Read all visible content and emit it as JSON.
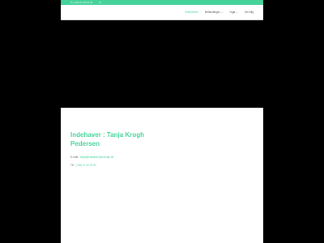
{
  "topbar": {
    "phone": "(+45) 21 43 43 00",
    "mail_icon": "envelope-icon",
    "phone_icon": "phone-icon"
  },
  "nav": {
    "items": [
      {
        "label": "Velkommen",
        "active": true,
        "dropdown": false
      },
      {
        "label": "Behandlinger",
        "active": false,
        "dropdown": true
      },
      {
        "label": "Yoga",
        "active": false,
        "dropdown": true
      },
      {
        "label": "Om Mig",
        "active": false,
        "dropdown": false
      }
    ]
  },
  "content": {
    "title": "Indehaver : Tanja Krogh Pedersen",
    "email_label": "E-mail:",
    "email_value": "tanja@holistisk-fysioterapi.dk",
    "tel_label": "Tlf:",
    "tel_value": "(+45) 21 43 43 00"
  },
  "colors": {
    "accent": "#46d39a",
    "background": "#000000"
  }
}
